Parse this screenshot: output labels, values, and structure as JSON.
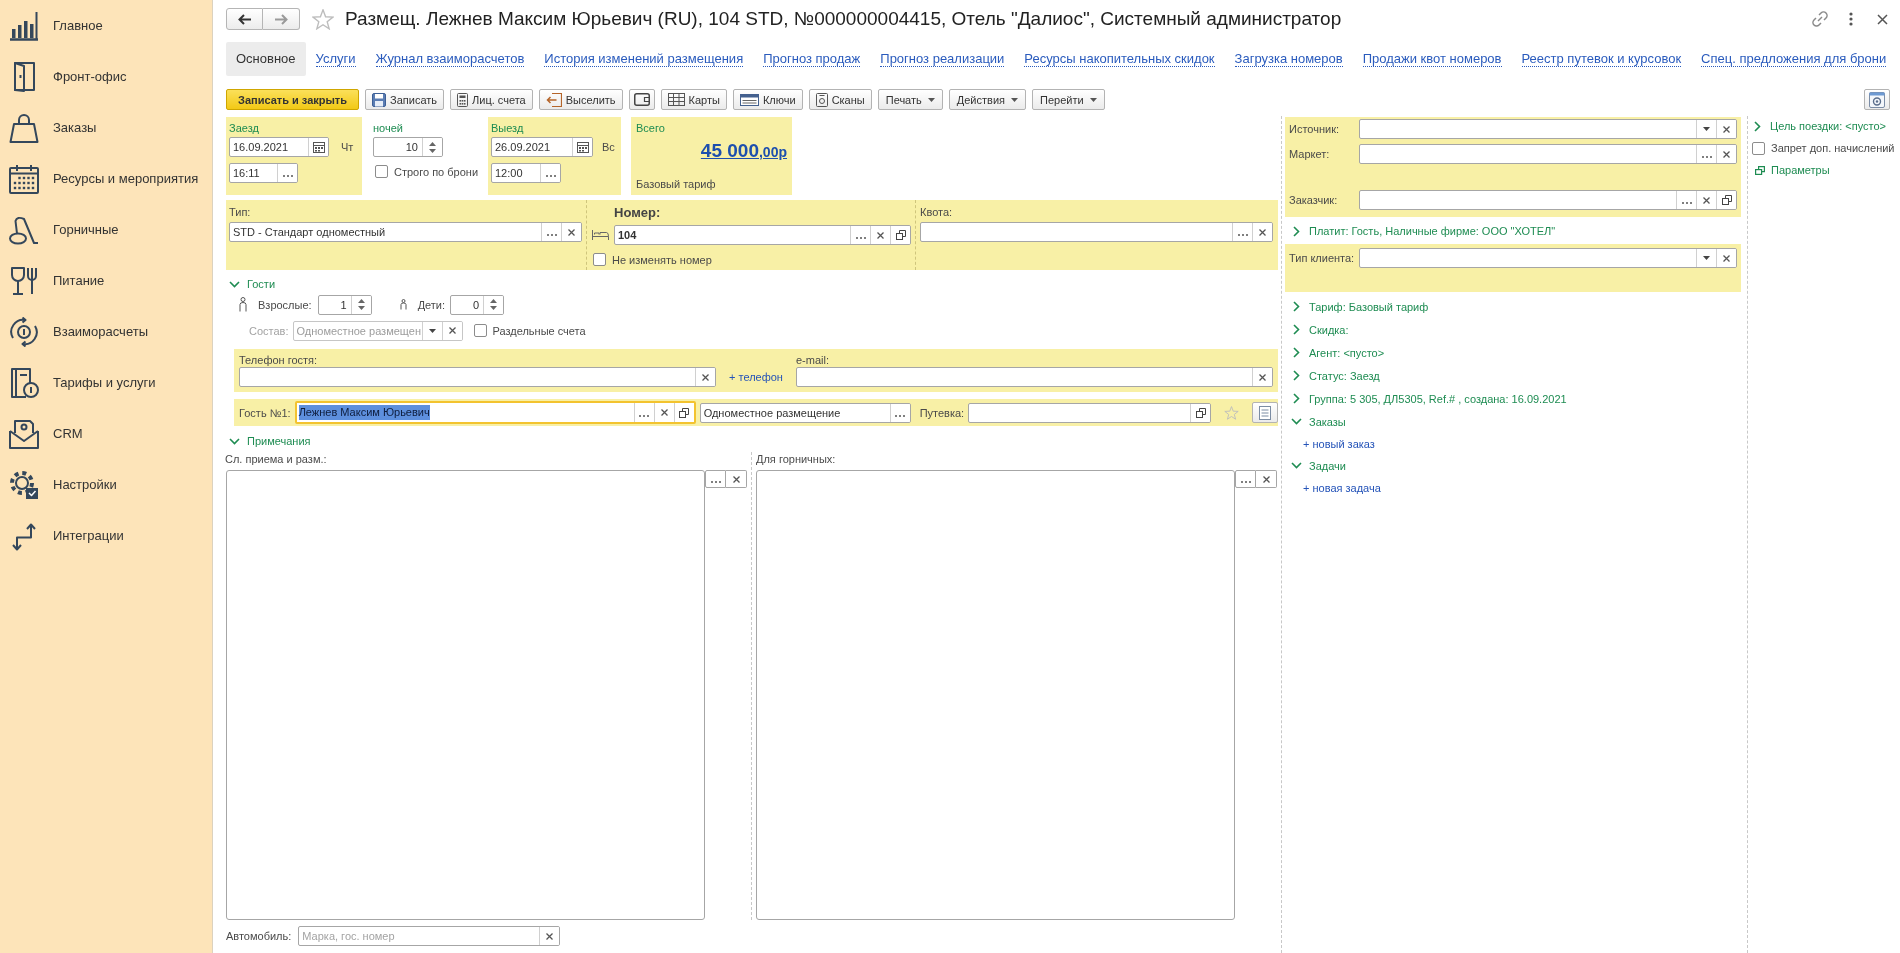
{
  "sidebar": {
    "items": [
      {
        "label": "Главное",
        "selected": false
      },
      {
        "label": "Фронт-офис",
        "selected": false
      },
      {
        "label": "Заказы",
        "selected": false
      },
      {
        "label": "Ресурсы и мероприятия",
        "selected": false
      },
      {
        "label": "Горничные",
        "selected": false
      },
      {
        "label": "Питание",
        "selected": false
      },
      {
        "label": "Взаиморасчеты",
        "selected": false
      },
      {
        "label": "Тарифы и услуги",
        "selected": false
      },
      {
        "label": "CRM",
        "selected": false
      },
      {
        "label": "Настройки",
        "selected": false
      },
      {
        "label": "Интеграции",
        "selected": false
      }
    ]
  },
  "header": {
    "title": "Размещ. Лежнев Максим Юрьевич (RU), 104 STD, №000000004415, Отель \"Далиос\", Системный администратор",
    "favorite": false
  },
  "tabs": [
    {
      "label": "Основное",
      "selected": true
    },
    {
      "label": "Услуги",
      "selected": false
    },
    {
      "label": "Журнал взаиморасчетов",
      "selected": false
    },
    {
      "label": "История изменений размещения",
      "selected": false
    },
    {
      "label": "Прогноз продаж",
      "selected": false
    },
    {
      "label": "Прогноз реализации",
      "selected": false
    },
    {
      "label": "Ресурсы накопительных скидок",
      "selected": false
    },
    {
      "label": "Загрузка номеров",
      "selected": false
    },
    {
      "label": "Продажи квот номеров",
      "selected": false
    },
    {
      "label": "Реестр путевок и курсовок",
      "selected": false
    },
    {
      "label": "Спец. предложения для брони",
      "selected": false
    }
  ],
  "toolbar": {
    "buttons": [
      {
        "kind": "primary",
        "label": "Записать и закрыть"
      },
      {
        "kind": "icon_text",
        "label": "Записать"
      },
      {
        "kind": "icon_text",
        "label": "Лиц. счета"
      },
      {
        "kind": "icon_text",
        "label": "Выселить"
      },
      {
        "kind": "icon"
      },
      {
        "kind": "icon_text",
        "label": "Карты"
      },
      {
        "kind": "icon_text",
        "label": "Ключи"
      },
      {
        "kind": "icon_text",
        "label": "Сканы"
      },
      {
        "kind": "menu",
        "label": "Печать"
      },
      {
        "kind": "menu",
        "label": "Действия"
      },
      {
        "kind": "menu",
        "label": "Перейти"
      }
    ]
  },
  "stay": {
    "checkin": {
      "label": "Заезд",
      "date": "16.09.2021",
      "weekday": "Чт",
      "time": "16:11"
    },
    "nights": {
      "label": "ночей",
      "value": "10"
    },
    "strict": {
      "label": "Строго по брони",
      "checked": false
    },
    "checkout": {
      "label": "Выезд",
      "date": "26.09.2021",
      "weekday": "Вс",
      "time": "12:00"
    },
    "total": {
      "label": "Всего",
      "amount": "45 000",
      "fraction": ",00р",
      "tariff": "Базовый тариф"
    }
  },
  "room": {
    "type": {
      "label": "Тип:",
      "value": "STD - Стандарт одноместный"
    },
    "number": {
      "label": "Номер:",
      "value": "104"
    },
    "keep_number": {
      "label": "Не изменять номер",
      "checked": false
    },
    "quota": {
      "label": "Квота:"
    }
  },
  "guests": {
    "label": "Гости",
    "expanded": true,
    "adults": {
      "label": "Взрослые:",
      "value": "1"
    },
    "children": {
      "label": "Дети:",
      "value": "0"
    },
    "composition": {
      "label": "Состав:",
      "value": "Одноместное размещен",
      "disabled": true
    },
    "separate_accounts": {
      "label": "Раздельные счета",
      "checked": false
    },
    "phone": {
      "label": "Телефон гостя:"
    },
    "add_phone": "+ телефон",
    "email": {
      "label": "e-mail:"
    },
    "guest": {
      "label": "Гость №1:",
      "name": "Лежнев Максим Юрьевич",
      "focused": true,
      "accommodation": "Одноместное размещение",
      "starred": false
    },
    "voucher": {
      "label": "Путевка:"
    }
  },
  "notes": {
    "label": "Примечания",
    "expanded": true,
    "reception": {
      "label": "Сл. приема и разм.:"
    },
    "housekeeping": {
      "label": "Для горничных:"
    }
  },
  "car": {
    "label": "Автомобиль:",
    "placeholder": "Марка, гос. номер"
  },
  "client": {
    "source": {
      "label": "Источник:"
    },
    "market": {
      "label": "Маркет:"
    },
    "customer": {
      "label": "Заказчик:"
    },
    "payer": {
      "label": "Платит: Гость, Наличные фирме: ООО \"ХОТЕЛ\"",
      "expanded": false
    },
    "client_type": {
      "label": "Тип клиента:"
    },
    "sections": [
      {
        "label": "Тариф: Базовый тариф",
        "expanded": false
      },
      {
        "label": "Скидка:",
        "expanded": false
      },
      {
        "label": "Агент: <пусто>",
        "expanded": false
      },
      {
        "label": "Статус: Заезд",
        "expanded": false
      },
      {
        "label": "Группа: 5 305, ДЛ5305, Ref.# , создана: 16.09.2021",
        "expanded": false
      },
      {
        "label": "Заказы",
        "expanded": true,
        "link": "+ новый заказ"
      },
      {
        "label": "Задачи",
        "expanded": true,
        "link": "+ новая задача"
      }
    ]
  },
  "extra": {
    "purpose": {
      "label": "Цель поездки: <пусто>",
      "expanded": false
    },
    "no_extra_charges": {
      "label": "Запрет доп. начислений",
      "checked": false
    },
    "parameters": "Параметры"
  }
}
